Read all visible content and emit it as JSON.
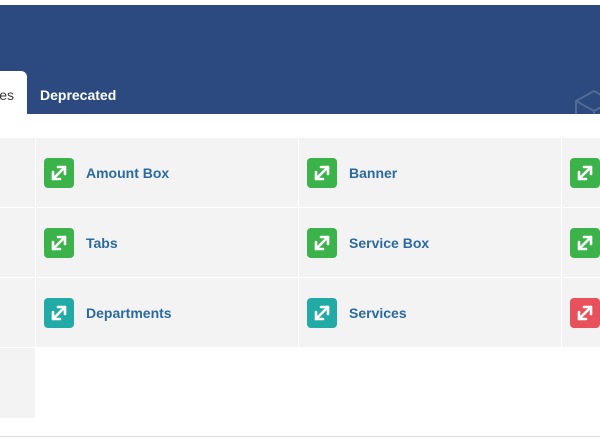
{
  "tabs": {
    "active_label": "Modules",
    "inactive_label": "Deprecated"
  },
  "modules": [
    {
      "label": "Amount Box",
      "color": "#3bb34a",
      "icon": "module-arrows-icon"
    },
    {
      "label": "Banner",
      "color": "#3bb34a",
      "icon": "module-arrows-icon"
    },
    {
      "label": "Tabs",
      "color": "#3bb34a",
      "icon": "module-arrows-icon"
    },
    {
      "label": "Service Box",
      "color": "#3bb34a",
      "icon": "module-arrows-icon"
    },
    {
      "label": "Departments",
      "color": "#22aaa6",
      "icon": "module-arrows-icon"
    },
    {
      "label": "Services",
      "color": "#22aaa6",
      "icon": "module-arrows-icon"
    }
  ],
  "edge_icon_colors": [
    "#3bb34a",
    "#3bb34a",
    "#e8505b"
  ],
  "colors": {
    "header": "#2c4a7f",
    "link": "#2b6aa0",
    "cell": "#f3f3f3"
  }
}
